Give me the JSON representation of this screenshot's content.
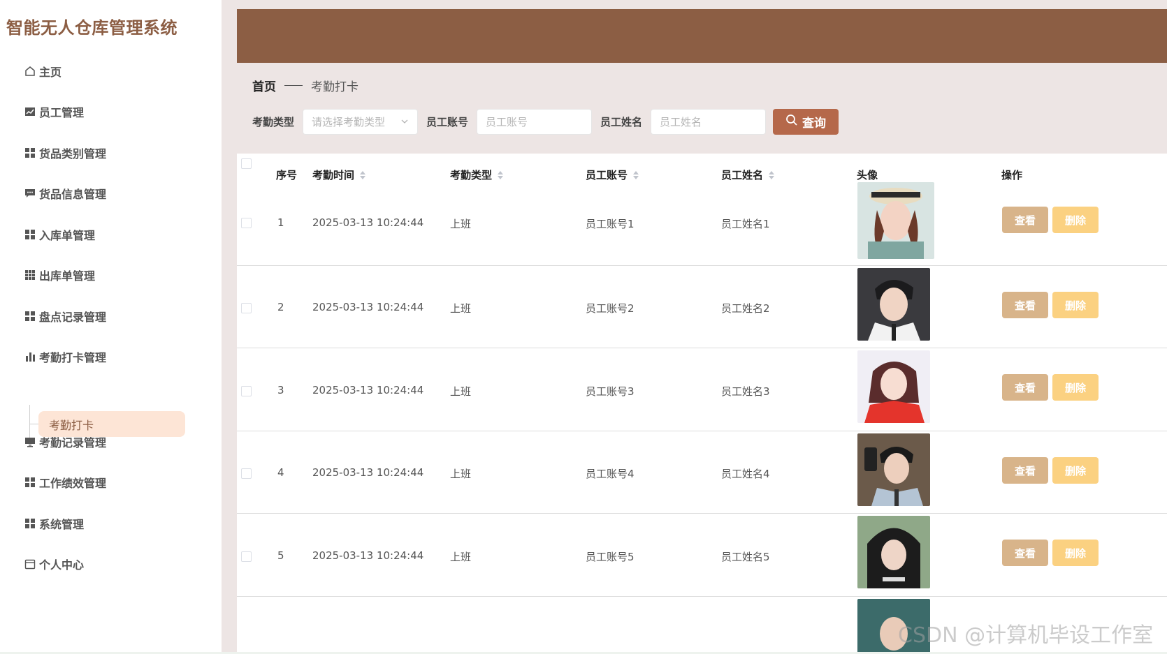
{
  "app": {
    "title": "智能无人仓库管理系统"
  },
  "sidebar": {
    "items": [
      {
        "label": "主页",
        "icon": "home-icon"
      },
      {
        "label": "员工管理",
        "icon": "chart-icon"
      },
      {
        "label": "货品类别管理",
        "icon": "grid-icon"
      },
      {
        "label": "货品信息管理",
        "icon": "chat-icon"
      },
      {
        "label": "入库单管理",
        "icon": "grid-icon"
      },
      {
        "label": "出库单管理",
        "icon": "grid9-icon"
      },
      {
        "label": "盘点记录管理",
        "icon": "grid-icon"
      },
      {
        "label": "考勤打卡管理",
        "icon": "bar-chart-icon"
      },
      {
        "label": "考勤记录管理",
        "icon": "monitor-icon"
      },
      {
        "label": "工作绩效管理",
        "icon": "grid-icon"
      },
      {
        "label": "系统管理",
        "icon": "grid-icon"
      },
      {
        "label": "个人中心",
        "icon": "calendar-icon"
      }
    ],
    "submenu": {
      "label": "考勤打卡"
    }
  },
  "breadcrumb": {
    "home": "首页",
    "current": "考勤打卡"
  },
  "filters": {
    "type_label": "考勤类型",
    "type_placeholder": "请选择考勤类型",
    "account_label": "员工账号",
    "account_placeholder": "员工账号",
    "name_label": "员工姓名",
    "name_placeholder": "员工姓名",
    "search_label": "查询"
  },
  "table": {
    "headers": {
      "index": "序号",
      "time": "考勤时间",
      "type": "考勤类型",
      "account": "员工账号",
      "name": "员工姓名",
      "avatar": "头像",
      "actions": "操作"
    },
    "rows": [
      {
        "index": "1",
        "time": "2025-03-13 10:24:44",
        "type": "上班",
        "account": "员工账号1",
        "name": "员工姓名1"
      },
      {
        "index": "2",
        "time": "2025-03-13 10:24:44",
        "type": "上班",
        "account": "员工账号2",
        "name": "员工姓名2"
      },
      {
        "index": "3",
        "time": "2025-03-13 10:24:44",
        "type": "上班",
        "account": "员工账号3",
        "name": "员工姓名3"
      },
      {
        "index": "4",
        "time": "2025-03-13 10:24:44",
        "type": "上班",
        "account": "员工账号4",
        "name": "员工姓名4"
      },
      {
        "index": "5",
        "time": "2025-03-13 10:24:44",
        "type": "上班",
        "account": "员工账号5",
        "name": "员工姓名5"
      }
    ],
    "view_label": "查看",
    "delete_label": "删除"
  },
  "watermark": "CSDN @计算机毕设工作室",
  "colors": {
    "brand": "#8c5e44",
    "search_button": "#b5684a",
    "view_button": "#d8b48a",
    "delete_button": "#fbd181",
    "main_bg": "#ede5e4"
  }
}
